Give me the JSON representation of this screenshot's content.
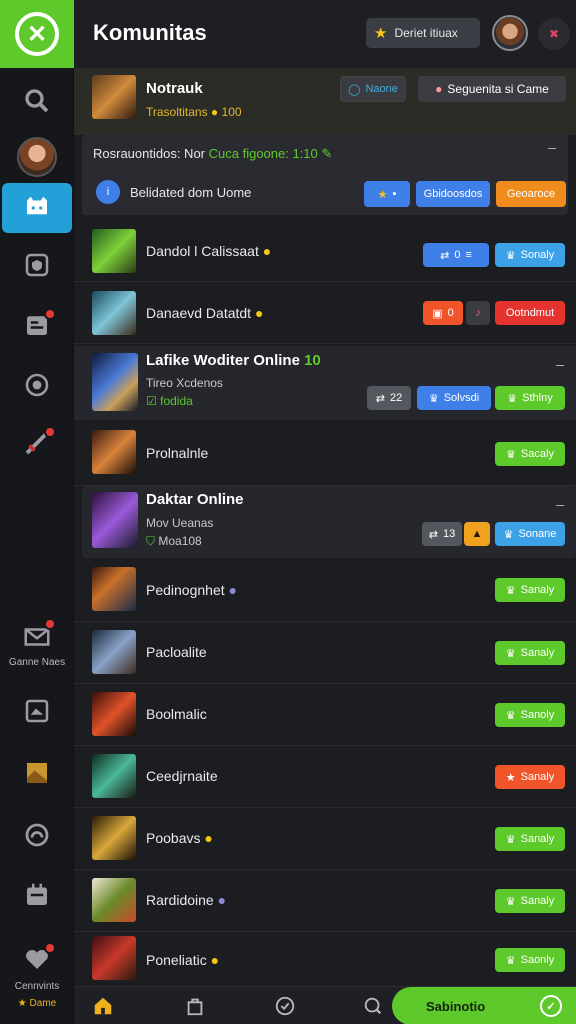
{
  "header": {
    "title": "Komunitas",
    "action_label": "Deriet itiuax",
    "action_icon": "star-icon",
    "close_icon": "close-icon"
  },
  "sidebar": {
    "logo_icon": "logo-icon",
    "items": [
      {
        "icon": "search-icon"
      },
      {
        "icon": "avatar-icon"
      },
      {
        "icon": "chat-cat-icon",
        "active": true
      },
      {
        "icon": "shield-icon"
      },
      {
        "icon": "inbox-icon",
        "badge": true
      },
      {
        "icon": "game-icon"
      },
      {
        "icon": "sword-icon",
        "badge": true
      }
    ],
    "bottom": [
      {
        "icon": "mail-icon",
        "label": "Ganne Naes",
        "badge": true
      },
      {
        "icon": "image-icon"
      },
      {
        "icon": "landscape-icon"
      },
      {
        "icon": "cloud-icon"
      },
      {
        "icon": "calendar-icon"
      },
      {
        "icon": "heart-icon",
        "label": "Cennvints",
        "badge": true
      },
      {
        "label": "Dame",
        "icon": "star-icon"
      }
    ]
  },
  "top_row": {
    "name": "Notrauk",
    "sub": "Trasoltitans",
    "sub_value": "100",
    "btn1": "Naone",
    "btn2": "Seguenita si Came"
  },
  "notice": {
    "text": "Rosrauontidos: Nor",
    "highlight": "Cuca figoone: 1:10",
    "line2": "Belidated dom Uome",
    "btn_a": "Gbidoosdos",
    "btn_b": "Geoaroce"
  },
  "rows": [
    {
      "name": "Dandol l Calissaat",
      "p1": "0",
      "p2": "Sonaly"
    },
    {
      "name": "Danaevd Datatdt",
      "p1": "0",
      "p2": "Ootndmut"
    },
    {
      "name": "Lafike Woditer Online",
      "num": "10",
      "sub1": "Tireo Xcdenos",
      "sub2": "fodida",
      "p1": "22",
      "p2": "Solvsdi",
      "p3": "Sthlny"
    },
    {
      "name": "Prolnalnle",
      "p3": "Sacaly"
    },
    {
      "name": "Daktar Online",
      "sub1": "Mov Ueanas",
      "sub2": "Moa108",
      "p1": "13",
      "p3": "Sonane"
    },
    {
      "name": "Pedinognhet",
      "p3": "Sanaly"
    },
    {
      "name": "Pacloalite",
      "p3": "Sanaly"
    },
    {
      "name": "Boolmalic",
      "p3": "Sanoly"
    },
    {
      "name": "Ceedjrnaite",
      "p3": "Sanaly"
    },
    {
      "name": "Poobavs",
      "p3": "Sanaly"
    },
    {
      "name": "Rardidoine",
      "p3": "Sanaly"
    },
    {
      "name": "Poneliatic",
      "p3": "Saonly"
    }
  ],
  "bottom_nav": {
    "items": [
      "home-icon",
      "bag-icon",
      "check-icon",
      "search-icon"
    ],
    "cta": "Sabinotio"
  }
}
